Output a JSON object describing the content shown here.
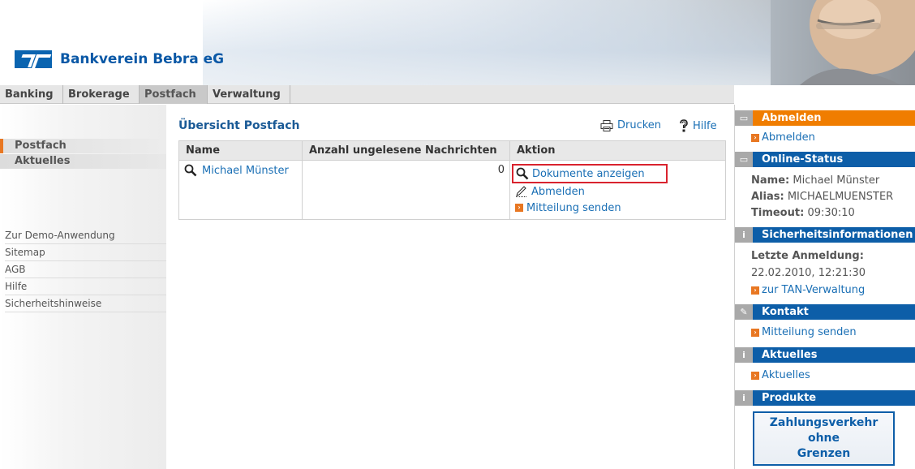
{
  "header": {
    "bank_name": "Bankverein Bebra eG"
  },
  "nav": {
    "tabs": [
      "Banking",
      "Brokerage",
      "Postfach",
      "Verwaltung"
    ],
    "active": "Postfach"
  },
  "sidebar": {
    "sections": [
      "Postfach",
      "Aktuelles"
    ],
    "links": [
      "Zur Demo-Anwendung",
      "Sitemap",
      "AGB",
      "Hilfe",
      "Sicherheitshinweise"
    ]
  },
  "main": {
    "title": "Übersicht Postfach",
    "print_label": "Drucken",
    "help_label": "Hilfe",
    "table": {
      "headers": [
        "Name",
        "Anzahl ungelesene Nachrichten",
        "Aktion"
      ],
      "rows": [
        {
          "name": "Michael Münster",
          "unread": "0",
          "actions": [
            "Dokumente anzeigen",
            "Abmelden",
            "Mitteilung senden"
          ]
        }
      ]
    }
  },
  "right": {
    "logout_header": "Abmelden",
    "logout_link": "Abmelden",
    "status_header": "Online-Status",
    "name_label": "Name:",
    "name_value": "Michael Münster",
    "alias_label": "Alias:",
    "alias_value": "MICHAELMUENSTER",
    "timeout_label": "Timeout:",
    "timeout_value": "09:30:10",
    "security_header": "Sicherheitsinformationen",
    "last_login_label": "Letzte Anmeldung:",
    "last_login_value": "22.02.2010, 12:21:30",
    "tan_link": "zur TAN-Verwaltung",
    "contact_header": "Kontakt",
    "contact_link": "Mitteilung senden",
    "news_header": "Aktuelles",
    "news_link": "Aktuelles",
    "products_header": "Produkte",
    "promo_lines": [
      "Zahlungsverkehr",
      "ohne",
      "Grenzen"
    ]
  },
  "colors": {
    "accent_orange": "#f07d00",
    "brand_blue": "#0d5ea8",
    "link_blue": "#1a6fb5",
    "highlight_red": "#d9232e"
  }
}
